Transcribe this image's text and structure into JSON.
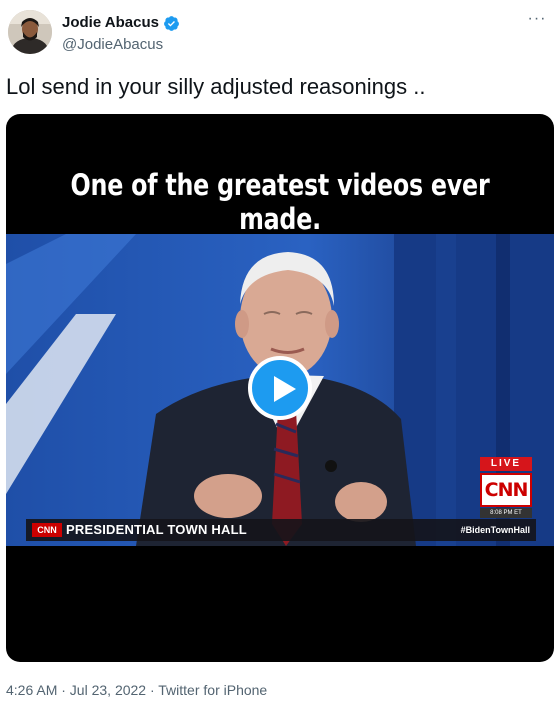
{
  "author": {
    "display_name": "Jodie Abacus",
    "handle": "@JodieAbacus",
    "avatar_icon": "user-avatar",
    "verified_icon": "verified-badge-icon"
  },
  "more_label": "···",
  "tweet_text": "Lol send in your silly adjusted reasonings ..",
  "media": {
    "caption": "One of the greatest videos ever made.",
    "play_icon": "play-icon",
    "broadcast": {
      "live_label": "LIVE",
      "network_logo": "CNN",
      "time": "8:08 PM ET",
      "lower_third_logo": "CNN",
      "lower_third_title": "PRESIDENTIAL TOWN HALL",
      "hashtag": "#BidenTownHall"
    }
  },
  "meta": "4:26 AM · Jul 23, 2022 · Twitter for iPhone",
  "colors": {
    "accent": "#1d9bf0",
    "secondary_text": "#536471",
    "cnn_red": "#cc0000"
  }
}
